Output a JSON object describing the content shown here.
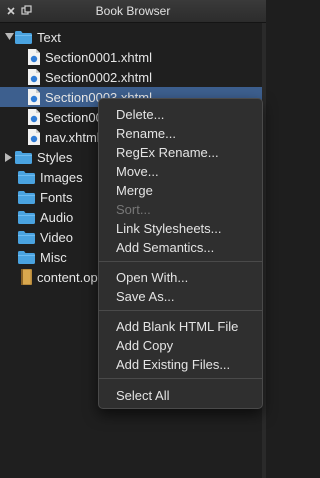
{
  "window": {
    "title": "Book Browser"
  },
  "tree": {
    "text_folder": "Text",
    "files": [
      "Section0001.xhtml",
      "Section0002.xhtml",
      "Section0003.xhtml",
      "Section0004.xhtml",
      "nav.xhtml"
    ],
    "folders": [
      "Styles",
      "Images",
      "Fonts",
      "Audio",
      "Video",
      "Misc"
    ],
    "opf": "content.opf"
  },
  "context_menu": {
    "delete": "Delete...",
    "rename": "Rename...",
    "regex_rename": "RegEx Rename...",
    "move": "Move...",
    "merge": "Merge",
    "sort": "Sort...",
    "link_stylesheets": "Link Stylesheets...",
    "add_semantics": "Add Semantics...",
    "open_with": "Open With...",
    "save_as": "Save As...",
    "add_blank_html": "Add Blank HTML File",
    "add_copy": "Add Copy",
    "add_existing": "Add Existing Files...",
    "select_all": "Select All"
  },
  "colors": {
    "selection": "#3d5f8e",
    "folder": "#4aa3e0",
    "menu_bg": "#2f2f2f"
  }
}
